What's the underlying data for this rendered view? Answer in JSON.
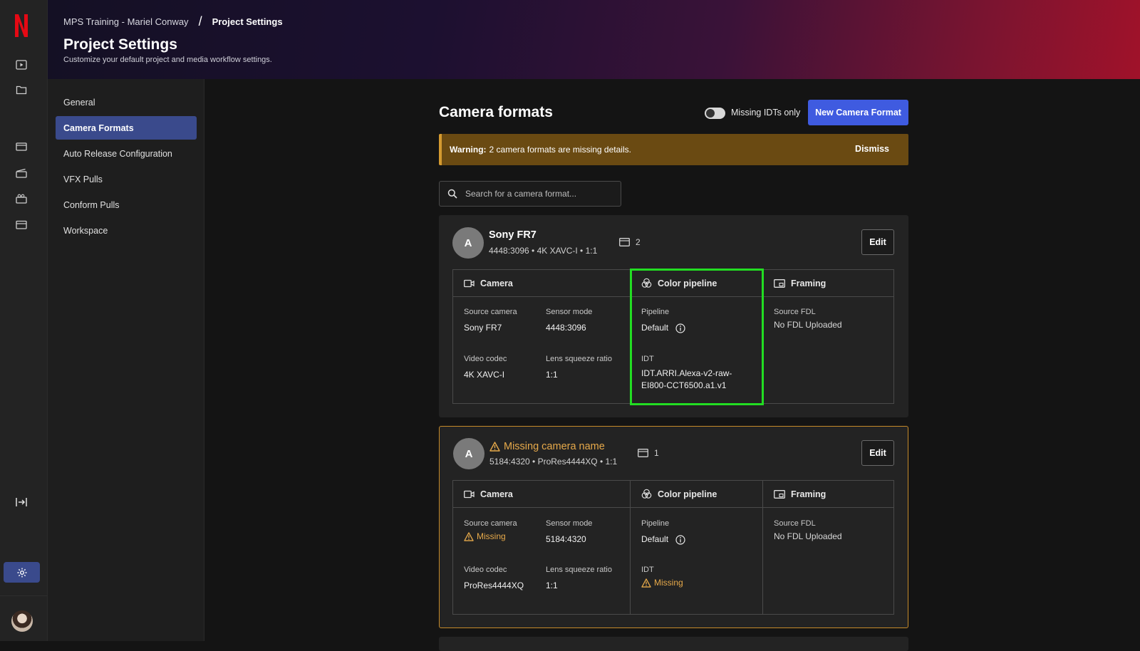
{
  "breadcrumb": {
    "project": "MPS Training - Mariel Conway",
    "separator": "/",
    "current": "Project Settings"
  },
  "header": {
    "title": "Project Settings",
    "subtitle": "Customize your default project and media workflow settings."
  },
  "rail": {
    "icons": [
      "netflix-logo",
      "play-icon",
      "folder-icon",
      "film-icon",
      "clapper-icon",
      "camera-slate-icon",
      "calendar-icon",
      "collapse-icon",
      "gear-icon"
    ],
    "accent": "#3a4a8c"
  },
  "subnav": {
    "items": [
      {
        "label": "General"
      },
      {
        "label": "Camera Formats",
        "active": true
      },
      {
        "label": "Auto Release Configuration"
      },
      {
        "label": "VFX Pulls"
      },
      {
        "label": "Conform Pulls"
      },
      {
        "label": "Workspace"
      }
    ]
  },
  "main": {
    "title": "Camera formats",
    "toggle_label": "Missing IDTs only",
    "toggle_on": false,
    "new_button": "New Camera Format",
    "warning": {
      "label": "Warning:",
      "text": "2 camera formats are missing details.",
      "dismiss": "Dismiss"
    },
    "search_placeholder": "Search for a camera format..."
  },
  "cards": [
    {
      "avatar": "A",
      "name": "Sony FR7",
      "meta": "4448:3096 • 4K XAVC-I • 1:1",
      "clips": "2",
      "edit": "Edit",
      "camera_head": "Camera",
      "color_head": "Color pipeline",
      "framing_head": "Framing",
      "source_camera_label": "Source camera",
      "source_camera": "Sony FR7",
      "sensor_mode_label": "Sensor mode",
      "sensor_mode": "4448:3096",
      "video_codec_label": "Video codec",
      "video_codec": "4K XAVC-I",
      "lens_label": "Lens squeeze ratio",
      "lens": "1:1",
      "pipeline_label": "Pipeline",
      "pipeline": "Default",
      "idt_label": "IDT",
      "idt": "IDT.ARRI.Alexa-v2-raw-EI800-CCT6500.a1.v1",
      "fdl_label": "Source FDL",
      "fdl": "No FDL Uploaded"
    },
    {
      "avatar": "A",
      "name": "Missing camera name",
      "meta": "5184:4320 • ProRes4444XQ • 1:1",
      "clips": "1",
      "edit": "Edit",
      "camera_head": "Camera",
      "color_head": "Color pipeline",
      "framing_head": "Framing",
      "source_camera_label": "Source camera",
      "source_camera": "Missing",
      "sensor_mode_label": "Sensor mode",
      "sensor_mode": "5184:4320",
      "video_codec_label": "Video codec",
      "video_codec": "ProRes4444XQ",
      "lens_label": "Lens squeeze ratio",
      "lens": "1:1",
      "pipeline_label": "Pipeline",
      "pipeline": "Default",
      "idt_label": "IDT",
      "idt": "Missing",
      "fdl_label": "Source FDL",
      "fdl": "No FDL Uploaded"
    }
  ],
  "colors": {
    "primary": "#3f5be0",
    "warning": "#e6a94a",
    "highlight": "#22dd22"
  }
}
